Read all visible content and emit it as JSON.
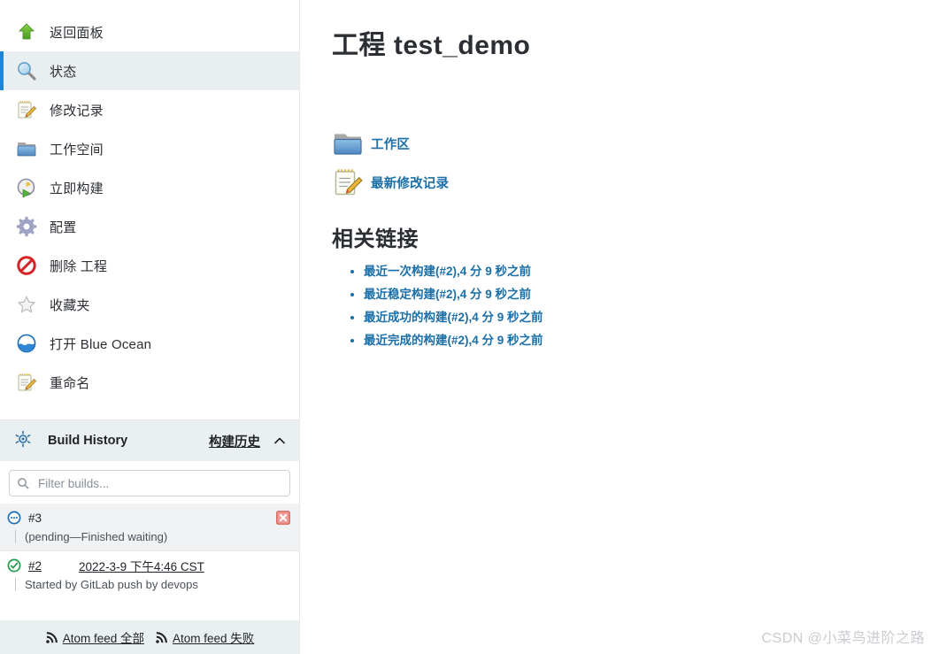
{
  "sidebar": {
    "tasks": [
      {
        "label": "返回面板",
        "icon": "up-arrow-icon",
        "name": "sidebar-item-back-to-dashboard",
        "active": false
      },
      {
        "label": "状态",
        "icon": "magnifier-icon",
        "name": "sidebar-item-status",
        "active": true
      },
      {
        "label": "修改记录",
        "icon": "notepad-pencil-icon",
        "name": "sidebar-item-changes",
        "active": false
      },
      {
        "label": "工作空间",
        "icon": "folder-icon",
        "name": "sidebar-item-workspace",
        "active": false
      },
      {
        "label": "立即构建",
        "icon": "build-now-clock-icon",
        "name": "sidebar-item-build-now",
        "active": false
      },
      {
        "label": "配置",
        "icon": "gear-icon",
        "name": "sidebar-item-configure",
        "active": false
      },
      {
        "label": "删除 工程",
        "icon": "delete-forbidden-icon",
        "name": "sidebar-item-delete-project",
        "active": false
      },
      {
        "label": "收藏夹",
        "icon": "star-icon",
        "name": "sidebar-item-favorites",
        "active": false
      },
      {
        "label": "打开 Blue Ocean",
        "icon": "blue-ocean-icon",
        "name": "sidebar-item-open-blue-ocean",
        "active": false
      },
      {
        "label": "重命名",
        "icon": "notepad-pencil-icon",
        "name": "sidebar-item-rename",
        "active": false
      }
    ],
    "build_history": {
      "icon": "jenkins-build-history-icon",
      "title": "Build History",
      "link_label": "构建历史",
      "collapse_icon": "chevron-up-icon",
      "filter_placeholder": "Filter builds...",
      "filter_value": "",
      "search_icon": "search-icon",
      "builds": [
        {
          "number": "#3",
          "status_icon": "pending-blue-icon",
          "date": "",
          "description": "(pending—Finished waiting)",
          "cancel_icon": "cancel-red-x-icon",
          "shaded": true,
          "number_linked": false
        },
        {
          "number": "#2",
          "status_icon": "success-green-check-icon",
          "date": "2022-3-9 下午4:46 CST",
          "description": "Started by GitLab push by devops",
          "cancel_icon": "",
          "shaded": false,
          "number_linked": true
        }
      ],
      "feeds": [
        {
          "label": "Atom feed 全部",
          "icon": "rss-icon",
          "name": "atom-feed-all-link"
        },
        {
          "label": "Atom feed 失败",
          "icon": "rss-icon",
          "name": "atom-feed-failed-link"
        }
      ]
    }
  },
  "main": {
    "title": "工程 test_demo",
    "jumps": [
      {
        "label": "工作区",
        "icon": "folder-icon",
        "name": "workspace-link"
      },
      {
        "label": "最新修改记录",
        "icon": "notepad-pencil-icon",
        "name": "recent-changes-link"
      }
    ],
    "links_section_title": "相关链接",
    "links": [
      "最近一次构建(#2),4 分 9 秒之前",
      "最近稳定构建(#2),4 分 9 秒之前",
      "最近成功的构建(#2),4 分 9 秒之前",
      "最近完成的构建(#2),4 分 9 秒之前"
    ]
  },
  "watermark": "CSDN @小菜鸟进阶之路",
  "colors": {
    "accent_blue": "#1e86d4",
    "link_blue": "#1a6fa8",
    "active_row_bg": "#e9eef1",
    "panel_bg": "#eaeff1",
    "success_green": "#1e9e4a",
    "cancel_red": "#e05b52"
  }
}
